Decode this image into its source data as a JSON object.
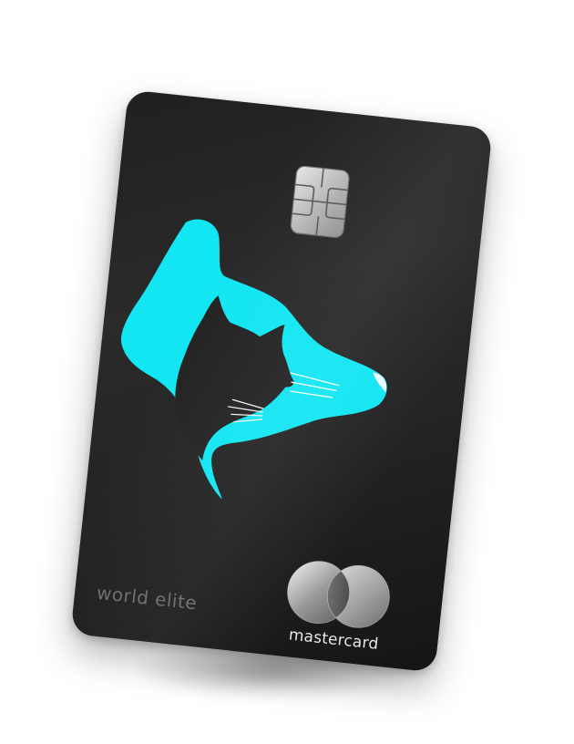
{
  "card": {
    "tier_label": "world elite",
    "network_name": "mastercard",
    "background_color": "#222222",
    "art_color": "#12e6f2",
    "icons": [
      "emv-chip-icon",
      "dog-and-cat-silhouette-icon",
      "mastercard-logo-icon"
    ]
  }
}
